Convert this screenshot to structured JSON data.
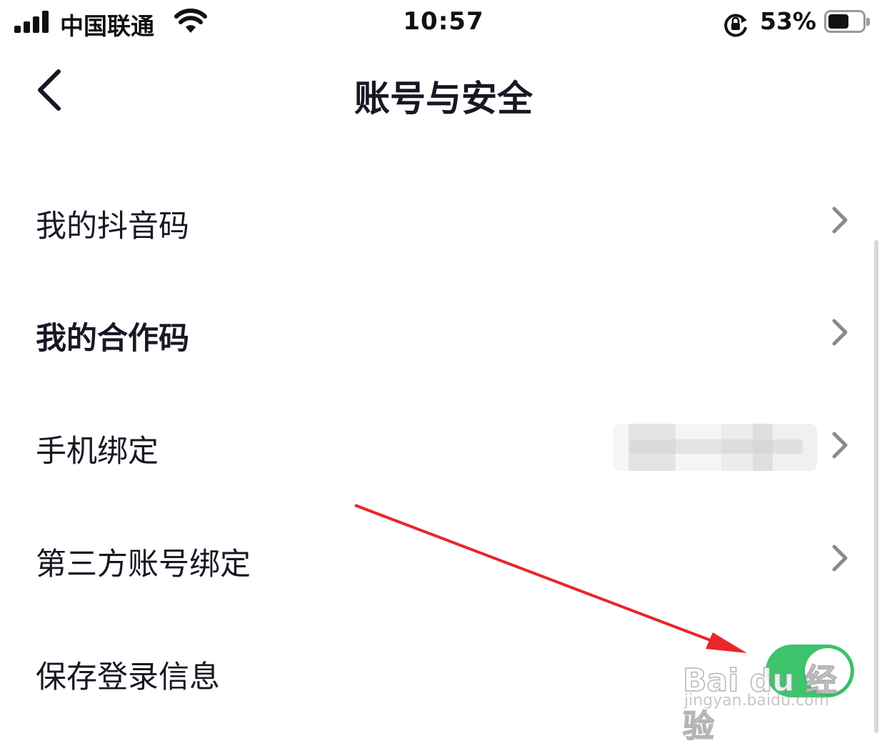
{
  "status_bar": {
    "carrier": "中国联通",
    "time": "10:57",
    "battery_percent": "53%",
    "battery_level": 0.53,
    "icons": [
      "signal-icon",
      "wifi-icon",
      "rotation-lock-icon",
      "battery-icon"
    ]
  },
  "nav": {
    "title": "账号与安全",
    "back_icon": "chevron-left-icon"
  },
  "list": [
    {
      "label": "我的抖音码",
      "control": "chevron"
    },
    {
      "label": "我的合作码",
      "control": "chevron"
    },
    {
      "label": "手机绑定",
      "control": "chevron",
      "value_masked": true
    },
    {
      "label": "第三方账号绑定",
      "control": "chevron"
    },
    {
      "label": "保存登录信息",
      "control": "toggle",
      "toggle_on": true
    }
  ],
  "colors": {
    "toggle_on": "#3ec36d",
    "annotation_arrow": "#e8262b",
    "text": "#161823",
    "chevron": "#888888"
  },
  "watermark": {
    "brand": "Bai du 经验",
    "url": "jingyan.baidu.com"
  }
}
